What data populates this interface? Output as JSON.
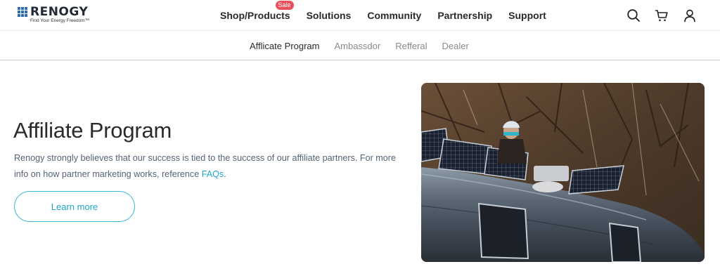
{
  "brand": {
    "name": "RENOGY",
    "tagline": "Find Your Energy Freedom™"
  },
  "nav": {
    "items": [
      {
        "label": "Shop/Products",
        "badge": "Sale"
      },
      {
        "label": "Solutions"
      },
      {
        "label": "Community"
      },
      {
        "label": "Partnership"
      },
      {
        "label": "Support"
      }
    ]
  },
  "header_icons": [
    "search-icon",
    "cart-icon",
    "user-icon"
  ],
  "subnav": {
    "items": [
      "Afflicate Program",
      "Ambassdor",
      "Refferal",
      "Dealer"
    ],
    "active": "Afflicate Program"
  },
  "hero": {
    "title": "Affiliate Program",
    "description": "Renogy strongly believes that our success is tied to the success of our affiliate partners. For more info on how partner marketing works, reference ",
    "link_text": "FAQs",
    "link_suffix": ".",
    "button_label": "Learn more"
  },
  "colors": {
    "accent": "#1fa6c9",
    "badge": "#e8505b",
    "brand_blue": "#2d6fb7"
  }
}
